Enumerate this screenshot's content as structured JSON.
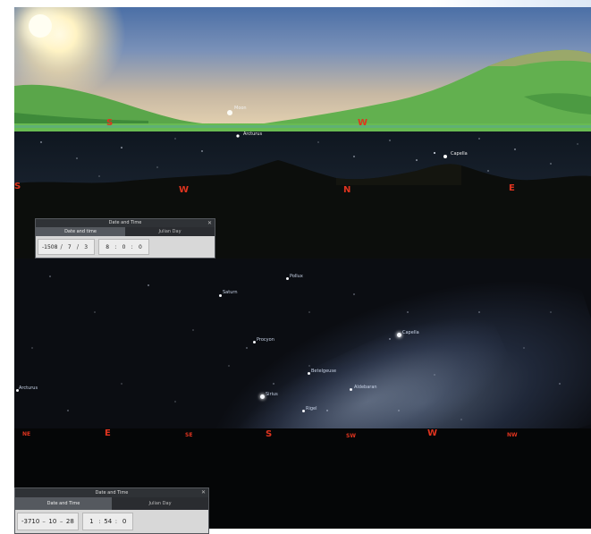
{
  "panel1": {
    "object_label": "Moon",
    "cardinals": [
      {
        "label": "S"
      },
      {
        "label": "W"
      }
    ]
  },
  "panel2": {
    "top_label": "Arcturus",
    "star_label": "Capella",
    "cardinals": [
      {
        "label": "S"
      },
      {
        "label": "W"
      },
      {
        "label": "N"
      },
      {
        "label": "E"
      }
    ],
    "dialog": {
      "title": "Date and Time",
      "tabs": [
        "Date and time",
        "Julian Day"
      ],
      "year": "-1508",
      "month": "7",
      "day": "3",
      "hour": "8",
      "minute": "0",
      "second": "0"
    }
  },
  "panel3": {
    "stars": [
      "Pollux",
      "Saturn",
      "Procyon",
      "Capella",
      "Betelgeuse",
      "Aldebaran",
      "Arcturus",
      "Sirius",
      "Rigel"
    ],
    "cardinals": [
      {
        "label": "NE"
      },
      {
        "label": "E"
      },
      {
        "label": "SE"
      },
      {
        "label": "S"
      },
      {
        "label": "SW"
      },
      {
        "label": "W"
      },
      {
        "label": "NW"
      }
    ],
    "dialog": {
      "title": "Date and Time",
      "tabs": [
        "Date and Time",
        "Julian Day"
      ],
      "year": "-3710",
      "month": "10",
      "day": "28",
      "hour": "1",
      "minute": "54",
      "second": "0"
    }
  },
  "colors": {
    "cardinal": "#e0341f",
    "sky_day_top": "#4b6fa6",
    "terrain": "#5fb24e"
  }
}
